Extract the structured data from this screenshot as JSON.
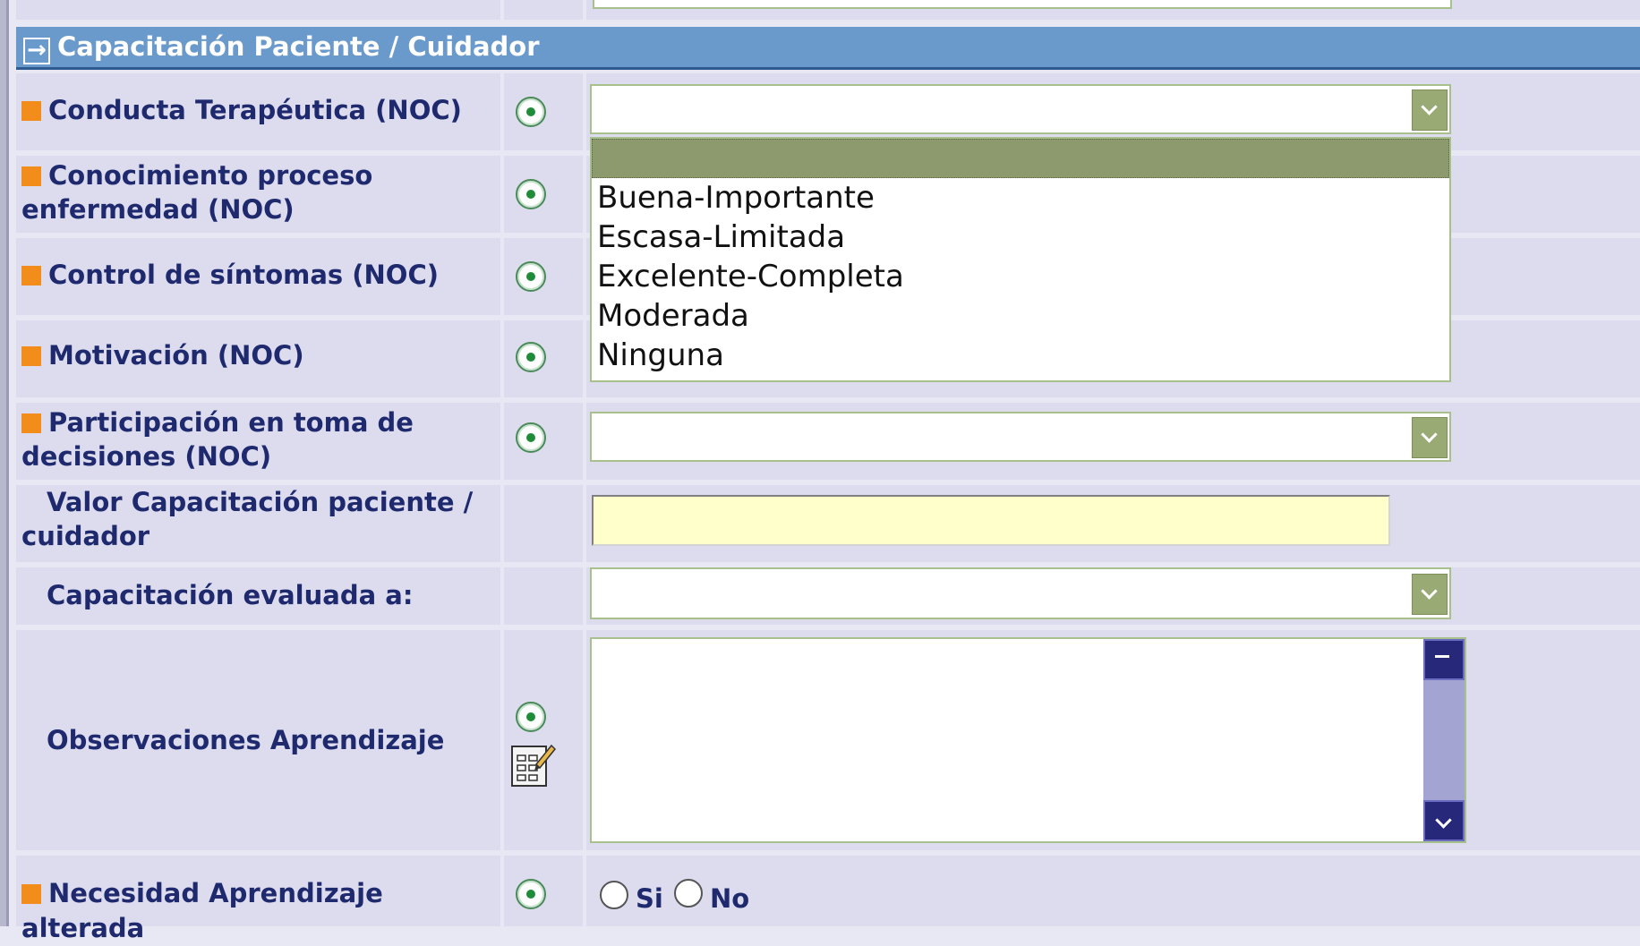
{
  "section": {
    "title": "Capacitación Paciente / Cuidador",
    "icon": "arrow-right-icon"
  },
  "rows": {
    "conducta": "Conducta Terapéutica (NOC)",
    "conocimiento_1": "Conocimiento proceso",
    "conocimiento_2": "enfermedad (NOC)",
    "control": "Control de síntomas (NOC)",
    "motivacion": "Motivación (NOC)",
    "participacion_1": "Participación en toma de",
    "participacion_2": "decisiones (NOC)",
    "valor_1": "Valor Capacitación paciente /",
    "valor_2": "cuidador",
    "evaluada": "Capacitación evaluada a:",
    "observaciones": "Observaciones Aprendizaje",
    "necesidad": "Necesidad Aprendizaje alterada"
  },
  "dropdown": {
    "selected": "",
    "options": [
      "Buena-Importante",
      "Escasa-Limitada",
      "Excelente-Completa",
      "Moderada",
      "Ninguna"
    ]
  },
  "inputs": {
    "valor_capacitacion": "",
    "observaciones": ""
  },
  "yes_no": {
    "yes": "Si",
    "no": "No"
  },
  "colors": {
    "header": "#6a9acb",
    "label": "#1f2a6e",
    "required_marker": "#f28c1b",
    "input_highlight": "#ffffcc"
  }
}
